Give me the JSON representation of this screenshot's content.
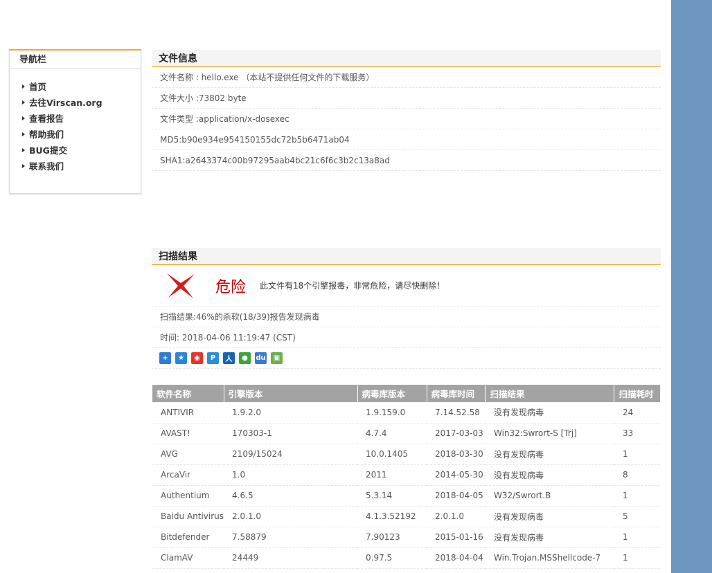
{
  "nav": {
    "title": "导航栏",
    "items": [
      "首页",
      "去往Virscan.org",
      "查看报告",
      "帮助我们",
      "BUG提交",
      "联系我们"
    ]
  },
  "file_info": {
    "title": "文件信息",
    "rows": [
      "文件名称 : hello.exe （本站不提供任何文件的下载服务）",
      "文件大小 :73802 byte",
      "文件类型 :application/x-dosexec",
      "MD5:b90e934e954150155dc72b5b6471ab04",
      "SHA1:a2643374c00b97295aab4bc21c6f6c3b2c13a8ad"
    ]
  },
  "scan": {
    "title": "扫描结果",
    "danger_label": "危险",
    "danger_desc": "此文件有18个引擎报毒，非常危险，请尽快删除！",
    "summary": "扫描结果:46%的杀软(18/39)报告发现病毒",
    "time": "时间: 2018-04-06 11:19:47 (CST)",
    "share_icons": [
      "plus-icon",
      "qzone-icon",
      "weibo-icon",
      "pengyou-icon",
      "renren-icon",
      "wechat-icon",
      "baidu-icon",
      "share-icon"
    ]
  },
  "table": {
    "headers": [
      "软件名称",
      "引擎版本",
      "病毒库版本",
      "病毒库时间",
      "扫描结果",
      "扫描耗时"
    ],
    "rows": [
      {
        "name": "ANTIVIR",
        "engine": "1.9.2.0",
        "db": "1.9.159.0",
        "date": "7.14.52.58",
        "result": "没有发现病毒",
        "infected": false,
        "time": "24"
      },
      {
        "name": "AVAST!",
        "engine": "170303-1",
        "db": "4.7.4",
        "date": "2017-03-03",
        "result": "Win32:Swrort-S [Trj]",
        "infected": true,
        "time": "33"
      },
      {
        "name": "AVG",
        "engine": "2109/15024",
        "db": "10.0.1405",
        "date": "2018-03-30",
        "result": "没有发现病毒",
        "infected": false,
        "time": "1"
      },
      {
        "name": "ArcaVir",
        "engine": "1.0",
        "db": "2011",
        "date": "2014-05-30",
        "result": "没有发现病毒",
        "infected": false,
        "time": "8"
      },
      {
        "name": "Authentium",
        "engine": "4.6.5",
        "db": "5.3.14",
        "date": "2018-04-05",
        "result": "W32/Swrort.B",
        "infected": true,
        "time": "1"
      },
      {
        "name": "Baidu Antivirus",
        "engine": "2.0.1.0",
        "db": "4.1.3.52192",
        "date": "2.0.1.0",
        "result": "没有发现病毒",
        "infected": false,
        "time": "5"
      },
      {
        "name": "Bitdefender",
        "engine": "7.58879",
        "db": "7.90123",
        "date": "2015-01-16",
        "result": "没有发现病毒",
        "infected": false,
        "time": "1"
      },
      {
        "name": "ClamAV",
        "engine": "24449",
        "db": "0.97.5",
        "date": "2018-04-04",
        "result": "Win.Trojan.MSShellcode-7",
        "infected": true,
        "time": "1"
      }
    ]
  },
  "colors": {
    "accent": "#f5a623",
    "strip": "#6e97bf",
    "clean": "#118811",
    "virus": "#b81c1c",
    "danger": "#cc0000"
  }
}
